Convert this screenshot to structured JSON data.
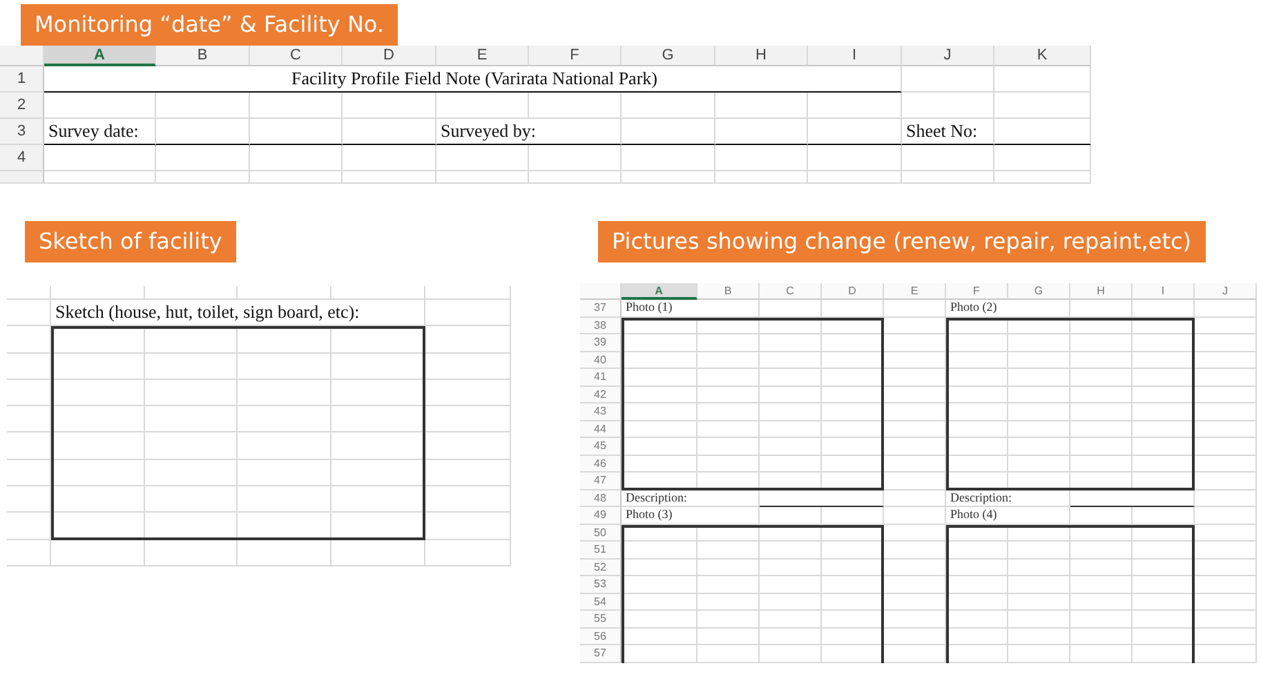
{
  "top_banner": "Monitoring “date” & Facility No.",
  "field_sheet": {
    "columns": [
      {
        "label": "A",
        "selected": true
      },
      {
        "label": "B",
        "selected": false
      },
      {
        "label": "C",
        "selected": false
      },
      {
        "label": "D",
        "selected": false
      },
      {
        "label": "E",
        "selected": false
      },
      {
        "label": "F",
        "selected": false
      },
      {
        "label": "G",
        "selected": false
      },
      {
        "label": "H",
        "selected": false
      },
      {
        "label": "I",
        "selected": false
      },
      {
        "label": "J",
        "selected": false
      },
      {
        "label": "K",
        "selected": false
      }
    ],
    "rows": [
      "1",
      "2",
      "3",
      "4"
    ],
    "title": "Facility Profile Field Note (Varirata National Park)",
    "fields": [
      "Survey date:",
      "Surveyed by:",
      "Sheet No:"
    ]
  },
  "sketch_banner": "Sketch of facility",
  "sketch_sheet": {
    "label": "Sketch (house, hut, toilet, sign board, etc):"
  },
  "photo_banner": "Pictures showing change (renew, repair, repaint,etc)",
  "photo_sheet": {
    "columns": [
      {
        "label": "A",
        "selected": true
      },
      {
        "label": "B",
        "selected": false
      },
      {
        "label": "C",
        "selected": false
      },
      {
        "label": "D",
        "selected": false
      },
      {
        "label": "E",
        "selected": false
      },
      {
        "label": "F",
        "selected": false
      },
      {
        "label": "G",
        "selected": false
      },
      {
        "label": "H",
        "selected": false
      },
      {
        "label": "I",
        "selected": false
      },
      {
        "label": "J",
        "selected": false
      }
    ],
    "rows": [
      "37",
      "38",
      "39",
      "40",
      "41",
      "42",
      "43",
      "44",
      "45",
      "46",
      "47",
      "48",
      "49",
      "50",
      "51",
      "52",
      "53",
      "54",
      "55",
      "56",
      "57"
    ],
    "photos": [
      {
        "label": "Photo (1)",
        "description": "Description:"
      },
      {
        "label": "Photo (2)",
        "description": "Description:"
      },
      {
        "label": "Photo (3)"
      },
      {
        "label": "Photo (4)"
      }
    ]
  }
}
